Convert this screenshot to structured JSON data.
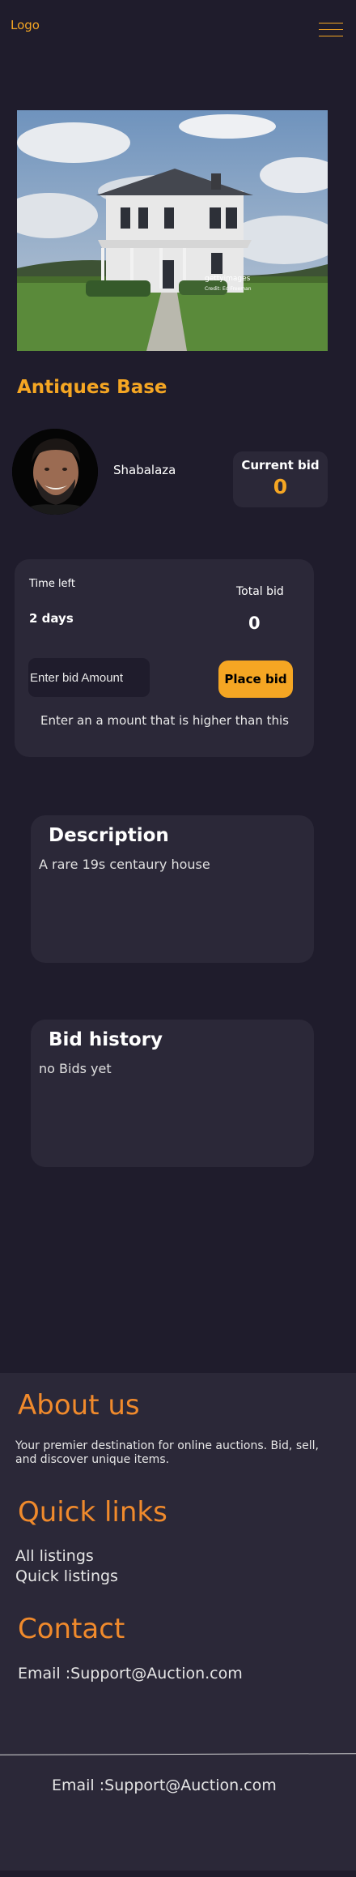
{
  "header": {
    "logo": "Logo",
    "menu_icon": "hamburger-menu-icon"
  },
  "listing": {
    "image_watermark": "gettyimages",
    "image_credit": "Credit: Ed Freeman",
    "title": "Antiques Base",
    "seller": "Shabalaza",
    "current_bid_label": "Current bid",
    "current_bid": "0"
  },
  "bid_panel": {
    "time_left_label": "Time left",
    "time_left": "2 days",
    "total_bid_label": "Total bid",
    "total_bid": "0",
    "bid_placeholder": "Enter bid Amount",
    "place_bid_label": "Place bid",
    "hint": "Enter an a mount that is higher than this"
  },
  "description": {
    "heading": "Description",
    "text": "A rare 19s centaury house"
  },
  "bid_history": {
    "heading": "Bid history",
    "text": "no Bids yet"
  },
  "footer": {
    "about_heading": "About us",
    "about_text": "Your premier destination for online auctions. Bid, sell, and discover unique items.",
    "links_heading": "Quick links",
    "links": [
      "All listings",
      "Quick listings"
    ],
    "contact_heading": "Contact",
    "contact_email": "Email :Support@Auction.com",
    "bottom_email": "Email :Support@Auction.com"
  },
  "colors": {
    "background": "#1f1c2c",
    "card": "#2b2838",
    "accent": "#f5a623",
    "footer_heading": "#f08a2c"
  }
}
